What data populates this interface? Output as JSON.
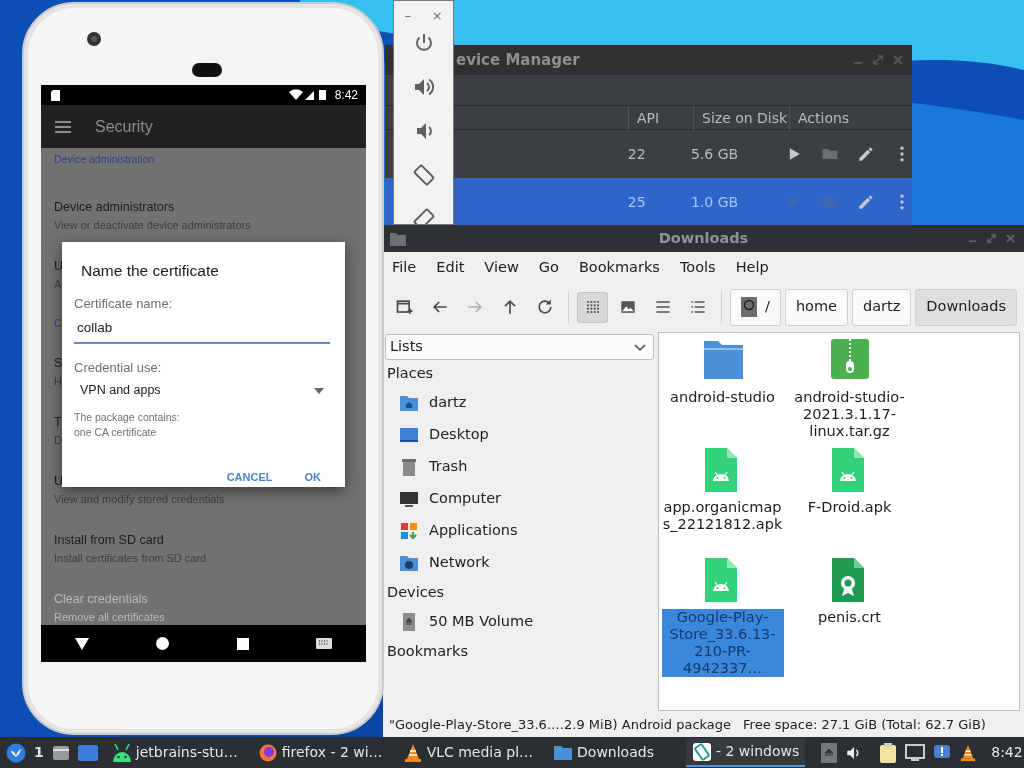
{
  "emulator_toolbar": {
    "minimize": "–",
    "close": "×"
  },
  "device_manager": {
    "title": "evice Manager",
    "columns": [
      "API",
      "Size on Disk",
      "Actions"
    ],
    "rows": [
      {
        "api": "22",
        "size": "5.6 GB",
        "selected": false
      },
      {
        "api": "25",
        "size": "1.0 GB",
        "selected": true
      }
    ]
  },
  "file_manager": {
    "title": "Downloads",
    "menu": [
      "File",
      "Edit",
      "View",
      "Go",
      "Bookmarks",
      "Tools",
      "Help"
    ],
    "nav_buttons": [
      {
        "kind": "new-window",
        "disabled": false
      },
      {
        "kind": "back",
        "disabled": false
      },
      {
        "kind": "forward",
        "disabled": true
      },
      {
        "kind": "up",
        "disabled": false
      },
      {
        "kind": "reload",
        "disabled": false
      }
    ],
    "view_buttons": [
      {
        "kind": "icons",
        "selected": true
      },
      {
        "kind": "thumbnails",
        "selected": false
      },
      {
        "kind": "compact",
        "selected": false
      },
      {
        "kind": "details",
        "selected": false
      }
    ],
    "path": [
      {
        "kind": "root",
        "label": "/",
        "selected": false
      },
      {
        "kind": "dir",
        "label": "home",
        "selected": false
      },
      {
        "kind": "dir",
        "label": "dartz",
        "selected": false
      },
      {
        "kind": "dir",
        "label": "Downloads",
        "selected": true
      }
    ],
    "side_view": "Lists",
    "sidebar": [
      {
        "kind": "header",
        "label": "Places"
      },
      {
        "kind": "home",
        "label": "dartz"
      },
      {
        "kind": "desktop",
        "label": "Desktop"
      },
      {
        "kind": "trash",
        "label": "Trash"
      },
      {
        "kind": "computer",
        "label": "Computer"
      },
      {
        "kind": "applications",
        "label": "Applications"
      },
      {
        "kind": "network",
        "label": "Network"
      },
      {
        "kind": "header",
        "label": "Devices"
      },
      {
        "kind": "volume",
        "label": "50 MB Volume"
      },
      {
        "kind": "header",
        "label": "Bookmarks"
      }
    ],
    "files": [
      {
        "kind": "folder",
        "name": "android-studio",
        "selected": false
      },
      {
        "kind": "archive",
        "name": "android-studio-2021.3.1.17-linux.tar.gz",
        "selected": false
      },
      {
        "kind": "apk",
        "name": "app.organicmaps_22121812.apk",
        "selected": false
      },
      {
        "kind": "apk",
        "name": "F-Droid.apk",
        "selected": false
      },
      {
        "kind": "apk",
        "name": "Google-Play-Store_33.6.13-210-PR-4942337…",
        "selected": true
      },
      {
        "kind": "certificate",
        "name": "penis.crt",
        "selected": false
      }
    ],
    "status": [
      "\"Google-Play-Store_33.6.…2.9 MiB) Android package",
      "Free space: 27.1 GiB (Total: 62.7 GiB)"
    ]
  },
  "phone": {
    "time": "8:42",
    "app_title": "Security",
    "list": [
      {
        "kind": "header",
        "title": "Device administration"
      },
      {
        "kind": "item",
        "title": "Device administrators",
        "subtitle": "View or deactivate device administrators",
        "disabled": false
      },
      {
        "kind": "item",
        "title": "U",
        "subtitle": "A",
        "disabled": false
      },
      {
        "kind": "header",
        "title": "C"
      },
      {
        "kind": "item",
        "title": "S",
        "subtitle": "H",
        "disabled": false
      },
      {
        "kind": "item",
        "title": "T",
        "subtitle": "D",
        "disabled": false
      },
      {
        "kind": "item",
        "title": "U",
        "subtitle": "View and modify stored credentials",
        "disabled": false
      },
      {
        "kind": "item",
        "title": "Install from SD card",
        "subtitle": "Install certificates from SD card",
        "disabled": false
      },
      {
        "kind": "item",
        "title": "Clear credentials",
        "subtitle": "Remove all certificates",
        "disabled": true
      }
    ],
    "dialog": {
      "title": "Name the certificate",
      "name_label": "Certificate name:",
      "name_value": "collab",
      "use_label": "Credential use:",
      "use_value": "VPN and apps",
      "note": [
        "The package contains:",
        "one CA certificate"
      ],
      "buttons": [
        "CANCEL",
        "OK"
      ]
    }
  },
  "taskbar": {
    "workspace": "1",
    "tasks": [
      {
        "kind": "android",
        "label": "jetbrains-stu…",
        "active": false
      },
      {
        "kind": "firefox",
        "label": "firefox - 2 wi…",
        "active": false
      },
      {
        "kind": "vlc",
        "label": "VLC media pl…",
        "active": false
      },
      {
        "kind": "folder",
        "label": "Downloads",
        "active": false
      },
      {
        "kind": "emulator",
        "label": "- 2 windows",
        "active": true
      }
    ],
    "clock": "8:42"
  }
}
